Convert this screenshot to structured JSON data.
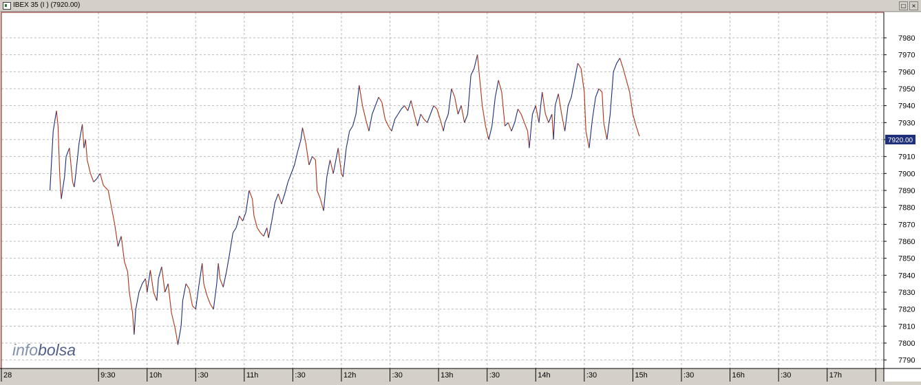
{
  "window": {
    "title": "IBEX 35 (I ) (7920.00)",
    "buttons": {
      "restore": "□",
      "close": "×"
    }
  },
  "chart_data": {
    "type": "line",
    "title": "IBEX 35 (I ) (7920.00)",
    "xlabel": "",
    "ylabel": "",
    "xlim": [
      "08:30",
      "17:35"
    ],
    "ylim": [
      7785,
      7995
    ],
    "grid": true,
    "y_axis_side": "right",
    "y_ticks": [
      7790,
      7800,
      7810,
      7820,
      7830,
      7840,
      7850,
      7860,
      7870,
      7880,
      7890,
      7900,
      7910,
      7920,
      7930,
      7940,
      7950,
      7960,
      7970,
      7980
    ],
    "x_ticks": [
      {
        "t": "08:30",
        "label": "28"
      },
      {
        "t": "09:30",
        "label": "9:30"
      },
      {
        "t": "10:00",
        "label": "10h"
      },
      {
        "t": "10:30",
        "label": ":30"
      },
      {
        "t": "11:00",
        "label": "11h"
      },
      {
        "t": "11:30",
        "label": ":30"
      },
      {
        "t": "12:00",
        "label": "12h"
      },
      {
        "t": "12:30",
        "label": ":30"
      },
      {
        "t": "13:00",
        "label": "13h"
      },
      {
        "t": "13:30",
        "label": ":30"
      },
      {
        "t": "14:00",
        "label": "14h"
      },
      {
        "t": "14:30",
        "label": ":30"
      },
      {
        "t": "15:00",
        "label": "15h"
      },
      {
        "t": "15:30",
        "label": ":30"
      },
      {
        "t": "16:00",
        "label": "16h"
      },
      {
        "t": "16:30",
        "label": ":30"
      },
      {
        "t": "17:00",
        "label": "17h"
      },
      {
        "t": "17:30",
        "label": ""
      }
    ],
    "last_value_label": "7920.00",
    "last_value": 7920,
    "watermark": {
      "part1": "info",
      "part2": "bolsa"
    },
    "series": [
      {
        "color_up": "#1c2a78",
        "color_down": "#b03010",
        "points": [
          [
            "09:00",
            7890
          ],
          [
            "09:02",
            7925
          ],
          [
            "09:04",
            7937
          ],
          [
            "09:05",
            7928
          ],
          [
            "09:06",
            7900
          ],
          [
            "09:07",
            7885
          ],
          [
            "09:09",
            7898
          ],
          [
            "09:10",
            7910
          ],
          [
            "09:12",
            7915
          ],
          [
            "09:13",
            7905
          ],
          [
            "09:14",
            7895
          ],
          [
            "09:15",
            7892
          ],
          [
            "09:16",
            7900
          ],
          [
            "09:18",
            7918
          ],
          [
            "09:20",
            7929
          ],
          [
            "09:21",
            7915
          ],
          [
            "09:22",
            7920
          ],
          [
            "09:23",
            7908
          ],
          [
            "09:25",
            7900
          ],
          [
            "09:27",
            7895
          ],
          [
            "09:29",
            7897
          ],
          [
            "09:31",
            7900
          ],
          [
            "09:33",
            7893
          ],
          [
            "09:36",
            7890
          ],
          [
            "09:38",
            7880
          ],
          [
            "09:40",
            7870
          ],
          [
            "09:42",
            7857
          ],
          [
            "09:44",
            7863
          ],
          [
            "09:46",
            7848
          ],
          [
            "09:48",
            7842
          ],
          [
            "09:49",
            7830
          ],
          [
            "09:51",
            7818
          ],
          [
            "09:52",
            7805
          ],
          [
            "09:53",
            7820
          ],
          [
            "09:55",
            7830
          ],
          [
            "09:57",
            7835
          ],
          [
            "09:59",
            7838
          ],
          [
            "10:00",
            7830
          ],
          [
            "10:02",
            7843
          ],
          [
            "10:04",
            7830
          ],
          [
            "10:06",
            7825
          ],
          [
            "10:07",
            7838
          ],
          [
            "10:09",
            7845
          ],
          [
            "10:11",
            7830
          ],
          [
            "10:13",
            7835
          ],
          [
            "10:15",
            7818
          ],
          [
            "10:17",
            7810
          ],
          [
            "10:18",
            7805
          ],
          [
            "10:19",
            7799
          ],
          [
            "10:21",
            7810
          ],
          [
            "10:22",
            7825
          ],
          [
            "10:24",
            7835
          ],
          [
            "10:26",
            7832
          ],
          [
            "10:28",
            7822
          ],
          [
            "10:30",
            7820
          ],
          [
            "10:32",
            7834
          ],
          [
            "10:34",
            7847
          ],
          [
            "10:35",
            7835
          ],
          [
            "10:37",
            7828
          ],
          [
            "10:39",
            7823
          ],
          [
            "10:41",
            7820
          ],
          [
            "10:43",
            7835
          ],
          [
            "10:44",
            7847
          ],
          [
            "10:45",
            7838
          ],
          [
            "10:47",
            7833
          ],
          [
            "10:49",
            7842
          ],
          [
            "10:51",
            7853
          ],
          [
            "10:53",
            7865
          ],
          [
            "10:55",
            7868
          ],
          [
            "10:57",
            7875
          ],
          [
            "10:59",
            7872
          ],
          [
            "11:01",
            7877
          ],
          [
            "11:03",
            7890
          ],
          [
            "11:05",
            7885
          ],
          [
            "11:06",
            7875
          ],
          [
            "11:08",
            7868
          ],
          [
            "11:10",
            7865
          ],
          [
            "11:12",
            7863
          ],
          [
            "11:14",
            7868
          ],
          [
            "11:15",
            7862
          ],
          [
            "11:17",
            7872
          ],
          [
            "11:19",
            7883
          ],
          [
            "11:21",
            7888
          ],
          [
            "11:23",
            7882
          ],
          [
            "11:25",
            7888
          ],
          [
            "11:27",
            7895
          ],
          [
            "11:29",
            7900
          ],
          [
            "11:31",
            7905
          ],
          [
            "11:33",
            7913
          ],
          [
            "11:35",
            7920
          ],
          [
            "11:36",
            7927
          ],
          [
            "11:38",
            7918
          ],
          [
            "11:40",
            7905
          ],
          [
            "11:42",
            7910
          ],
          [
            "11:44",
            7908
          ],
          [
            "11:45",
            7890
          ],
          [
            "11:47",
            7885
          ],
          [
            "11:49",
            7878
          ],
          [
            "11:51",
            7898
          ],
          [
            "11:53",
            7908
          ],
          [
            "11:55",
            7900
          ],
          [
            "11:56",
            7905
          ],
          [
            "11:58",
            7915
          ],
          [
            "12:00",
            7900
          ],
          [
            "12:01",
            7898
          ],
          [
            "12:03",
            7915
          ],
          [
            "12:05",
            7925
          ],
          [
            "12:07",
            7928
          ],
          [
            "12:09",
            7935
          ],
          [
            "12:11",
            7952
          ],
          [
            "12:13",
            7940
          ],
          [
            "12:15",
            7932
          ],
          [
            "12:17",
            7925
          ],
          [
            "12:19",
            7935
          ],
          [
            "12:21",
            7940
          ],
          [
            "12:23",
            7945
          ],
          [
            "12:25",
            7942
          ],
          [
            "12:27",
            7932
          ],
          [
            "12:29",
            7928
          ],
          [
            "12:31",
            7925
          ],
          [
            "12:33",
            7932
          ],
          [
            "12:35",
            7935
          ],
          [
            "12:37",
            7938
          ],
          [
            "12:39",
            7940
          ],
          [
            "12:41",
            7937
          ],
          [
            "12:43",
            7943
          ],
          [
            "12:45",
            7935
          ],
          [
            "12:47",
            7928
          ],
          [
            "12:49",
            7935
          ],
          [
            "12:51",
            7932
          ],
          [
            "12:53",
            7930
          ],
          [
            "12:55",
            7935
          ],
          [
            "12:57",
            7940
          ],
          [
            "12:59",
            7938
          ],
          [
            "13:01",
            7932
          ],
          [
            "13:03",
            7925
          ],
          [
            "13:04",
            7930
          ],
          [
            "13:06",
            7935
          ],
          [
            "13:08",
            7950
          ],
          [
            "13:10",
            7945
          ],
          [
            "13:12",
            7935
          ],
          [
            "13:14",
            7940
          ],
          [
            "13:16",
            7930
          ],
          [
            "13:18",
            7935
          ],
          [
            "13:20",
            7958
          ],
          [
            "13:22",
            7962
          ],
          [
            "13:24",
            7970
          ],
          [
            "13:25",
            7960
          ],
          [
            "13:27",
            7940
          ],
          [
            "13:29",
            7928
          ],
          [
            "13:31",
            7920
          ],
          [
            "13:33",
            7928
          ],
          [
            "13:35",
            7945
          ],
          [
            "13:37",
            7955
          ],
          [
            "13:39",
            7948
          ],
          [
            "13:41",
            7928
          ],
          [
            "13:43",
            7930
          ],
          [
            "13:45",
            7925
          ],
          [
            "13:47",
            7930
          ],
          [
            "13:49",
            7938
          ],
          [
            "13:51",
            7935
          ],
          [
            "13:53",
            7930
          ],
          [
            "13:55",
            7925
          ],
          [
            "13:56",
            7915
          ],
          [
            "13:58",
            7935
          ],
          [
            "14:00",
            7940
          ],
          [
            "14:02",
            7930
          ],
          [
            "14:04",
            7948
          ],
          [
            "14:06",
            7935
          ],
          [
            "14:08",
            7930
          ],
          [
            "14:10",
            7935
          ],
          [
            "14:11",
            7920
          ],
          [
            "14:12",
            7940
          ],
          [
            "14:14",
            7947
          ],
          [
            "14:16",
            7935
          ],
          [
            "14:18",
            7925
          ],
          [
            "14:20",
            7940
          ],
          [
            "14:22",
            7945
          ],
          [
            "14:24",
            7955
          ],
          [
            "14:26",
            7965
          ],
          [
            "14:28",
            7962
          ],
          [
            "14:30",
            7948
          ],
          [
            "14:31",
            7925
          ],
          [
            "14:33",
            7915
          ],
          [
            "14:35",
            7932
          ],
          [
            "14:37",
            7945
          ],
          [
            "14:39",
            7950
          ],
          [
            "14:41",
            7948
          ],
          [
            "14:42",
            7930
          ],
          [
            "14:44",
            7920
          ],
          [
            "14:46",
            7935
          ],
          [
            "14:48",
            7960
          ],
          [
            "14:50",
            7965
          ],
          [
            "14:52",
            7968
          ],
          [
            "14:54",
            7962
          ],
          [
            "14:56",
            7955
          ],
          [
            "14:58",
            7948
          ],
          [
            "15:00",
            7935
          ],
          [
            "15:02",
            7928
          ],
          [
            "15:04",
            7922
          ]
        ]
      }
    ]
  }
}
